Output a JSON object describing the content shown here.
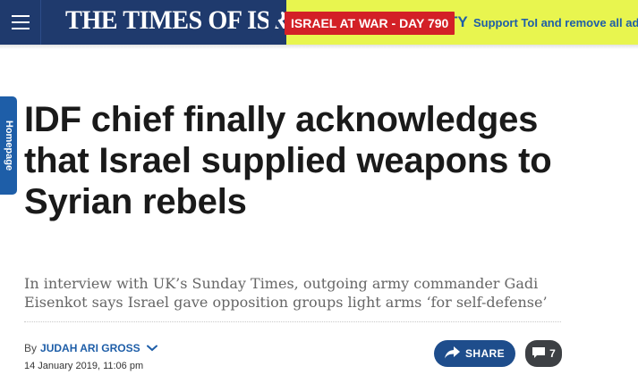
{
  "header": {
    "logo_text": "THE TIMES OF ISRAEL",
    "war_badge": "ISRAEL AT WAR - DAY 790",
    "promo_partial": "NITY",
    "support_link": "Support ToI and remove all ads",
    "colors": {
      "nav": "#1f3a6d",
      "promo_bg": "#e8f54f",
      "badge": "#d32027",
      "link": "#1e5ea8"
    }
  },
  "side_tab": {
    "label": "Homepage"
  },
  "article": {
    "headline": "IDF chief finally acknowledges that Israel supplied weapons to Syrian rebels",
    "subhead": "In interview with UK’s Sunday Times, outgoing army commander Gadi Eisenkot says Israel gave opposition groups light arms ‘for self-defense’",
    "byline_prefix": "By",
    "author": "JUDAH ARI GROSS",
    "date": "14 January 2019, 11:06 pm",
    "share_label": "SHARE",
    "comment_count": "7"
  },
  "icons": [
    "menu-icon",
    "share-arrow-icon",
    "comment-icon",
    "chevron-down-icon"
  ]
}
